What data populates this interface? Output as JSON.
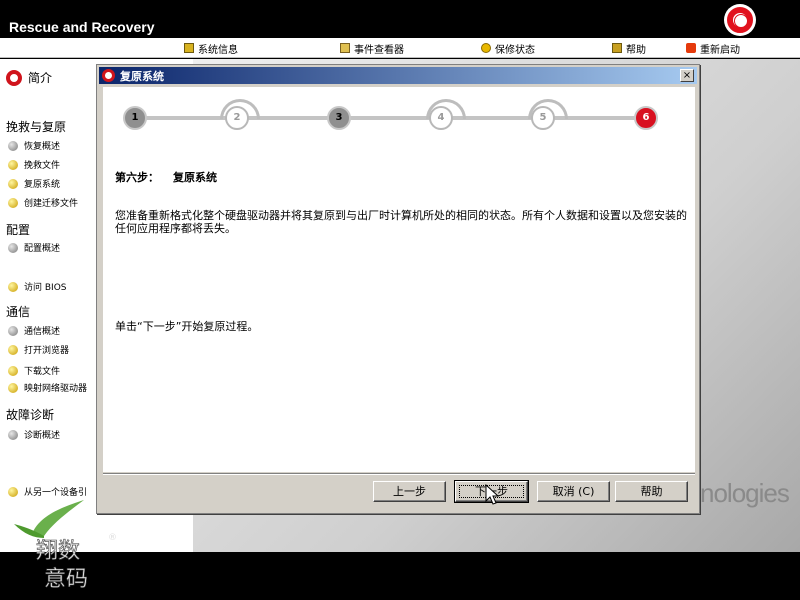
{
  "app": {
    "title": "Rescue and Recovery"
  },
  "menu": {
    "items": [
      {
        "label": "系统信息",
        "icon": "info-icon"
      },
      {
        "label": "事件查看器",
        "icon": "log-icon"
      },
      {
        "label": "保修状态",
        "icon": "warranty-icon"
      },
      {
        "label": "帮助",
        "icon": "help-icon"
      },
      {
        "label": "重新启动",
        "icon": "restart-icon"
      }
    ]
  },
  "sidebar": {
    "home": "简介",
    "sections": [
      {
        "title": "挽救与复原",
        "items": [
          "恢复概述",
          "挽救文件",
          "复原系统",
          "创建迁移文件"
        ]
      },
      {
        "title": "配置",
        "items": [
          "配置概述",
          "访问 BIOS"
        ]
      },
      {
        "title": "通信",
        "items": [
          "通信概述",
          "打开浏览器",
          "下载文件",
          "映射网络驱动器"
        ]
      },
      {
        "title": "故障诊断",
        "items": [
          "诊断概述"
        ]
      }
    ],
    "footer_item": "从另一个设备引"
  },
  "background": {
    "brand_text": "nologies"
  },
  "dialog": {
    "title": "复原系统",
    "steps": [
      "1",
      "2",
      "3",
      "4",
      "5",
      "6"
    ],
    "current_step": 6,
    "step_heading_label": "第六步：",
    "step_heading_title": "复原系统",
    "body": "您准备重新格式化整个硬盘驱动器并将其复原到与出厂时计算机所处的相同的状态。所有个人数据和设置以及您安装的任何应用程序都将丢失。",
    "hint": "单击“下一步”开始复原过程。",
    "buttons": {
      "back": "上一步",
      "next": "下一步",
      "cancel": "取消 (C)",
      "help": "帮助"
    },
    "close_glyph": "×"
  },
  "watermark": {
    "text": "翔数意码",
    "reg": "®"
  }
}
